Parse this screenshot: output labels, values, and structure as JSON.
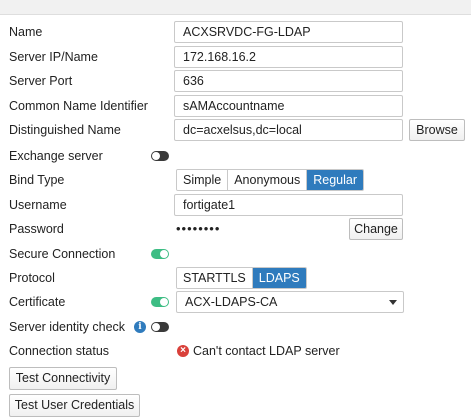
{
  "form": {
    "name": {
      "label": "Name",
      "value": "ACXSRVDC-FG-LDAP"
    },
    "server": {
      "label": "Server IP/Name",
      "value": "172.168.16.2"
    },
    "port": {
      "label": "Server Port",
      "value": "636"
    },
    "cn_identifier": {
      "label": "Common Name Identifier",
      "value": "sAMAccountname"
    },
    "distinguished_name": {
      "label": "Distinguished Name",
      "value": "dc=acxelsus,dc=local",
      "browse_label": "Browse"
    },
    "exchange_server": {
      "label": "Exchange server",
      "enabled": false
    },
    "bind_type": {
      "label": "Bind Type",
      "options": [
        "Simple",
        "Anonymous",
        "Regular"
      ],
      "selected": "Regular"
    },
    "username": {
      "label": "Username",
      "value": "fortigate1"
    },
    "password": {
      "label": "Password",
      "masked": "••••••••",
      "change_label": "Change"
    },
    "secure_connection": {
      "label": "Secure Connection",
      "enabled": true
    },
    "protocol": {
      "label": "Protocol",
      "options": [
        "STARTTLS",
        "LDAPS"
      ],
      "selected": "LDAPS"
    },
    "certificate": {
      "label": "Certificate",
      "enabled": true,
      "selected": "ACX-LDAPS-CA"
    },
    "server_identity_check": {
      "label": "Server identity check",
      "info_icon": "info-icon",
      "enabled": false
    },
    "connection_status": {
      "label": "Connection status",
      "status_icon": "error-icon",
      "text": "Can't contact LDAP server"
    }
  },
  "actions": {
    "test_connectivity": "Test Connectivity",
    "test_user_credentials": "Test User Credentials"
  },
  "colors": {
    "accent": "#2f7bbd",
    "toggle_on": "#3dbd84",
    "toggle_off": "#3a3a3a",
    "error": "#d9403a"
  }
}
